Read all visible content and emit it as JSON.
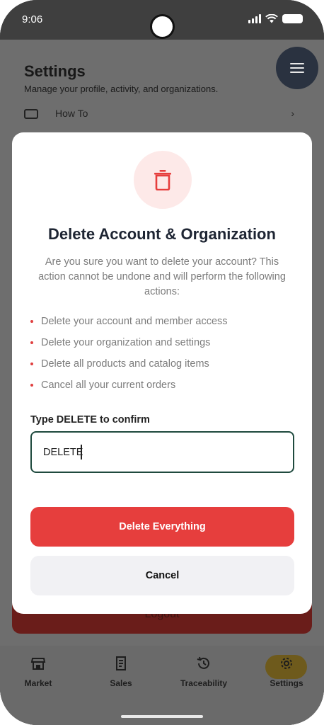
{
  "status_bar": {
    "time": "9:06"
  },
  "background": {
    "title": "Settings",
    "subtitle": "Manage your profile, activity, and organizations.",
    "row_label": "How To",
    "row_chevron": "›",
    "logout_label": "Logout",
    "menu_icon": "hamburger-icon"
  },
  "bottom_nav": {
    "items": [
      {
        "label": "Market",
        "icon": "store-icon"
      },
      {
        "label": "Sales",
        "icon": "receipt-icon"
      },
      {
        "label": "Traceability",
        "icon": "history-icon"
      },
      {
        "label": "Settings",
        "icon": "gear-icon",
        "active": true
      }
    ]
  },
  "modal": {
    "icon": "trash-icon",
    "title": "Delete Account & Organization",
    "description": "Are you sure you want to delete your account? This action cannot be undone and will perform the following actions:",
    "actions": [
      "Delete your account and member access",
      "Delete your organization and settings",
      "Delete all products and catalog items",
      "Cancel all your current orders"
    ],
    "confirm_label": "Type DELETE to confirm",
    "confirm_value": "DELETE",
    "delete_button": "Delete Everything",
    "cancel_button": "Cancel"
  },
  "colors": {
    "danger": "#e63e3d",
    "danger_soft": "#fde9e8",
    "input_border": "#1f4a3e",
    "title": "#1e2533"
  }
}
